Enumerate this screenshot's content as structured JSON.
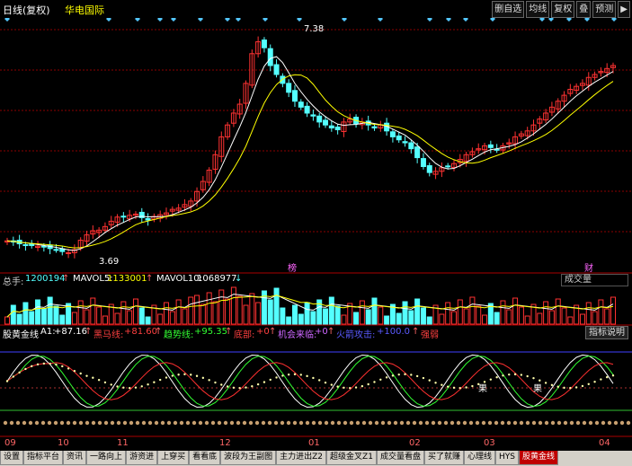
{
  "header": {
    "title": "日线(复权)",
    "stock_name": "华电国际",
    "colors": {
      "title": "#ffffff",
      "name": "#ffff00"
    }
  },
  "toolbar": [
    {
      "label": "删自选",
      "name": "remove-watchlist-button"
    },
    {
      "label": "均线",
      "name": "moving-average-button"
    },
    {
      "label": "复权",
      "name": "adjust-button"
    },
    {
      "label": "叠",
      "name": "overlay-button"
    },
    {
      "label": "预测",
      "name": "forecast-button"
    },
    {
      "label": "▶",
      "name": "expand-icon"
    }
  ],
  "price_chart": {
    "high_label": "7.38",
    "low_label": "3.69",
    "markers": [
      "榜",
      "财"
    ]
  },
  "volume": {
    "total_label": "总手:",
    "total_value": "1200194",
    "mavol5_label": "MAVOL5:",
    "mavol5_value": "1133001",
    "mavol10_label": "MAVOL10:",
    "mavol10_value": "1068977",
    "dropdown_value": "成交量"
  },
  "indicator": {
    "name": "股黄金线",
    "a1_label": "A1:",
    "a1_value": "+87.16",
    "black_horse_label": "黑马线:",
    "black_horse_value": "+81.60",
    "trend_label": "趋势线:",
    "trend_value": "+95.35",
    "bottom_label": "底部:",
    "bottom_value": "+0",
    "chance_label": "机会来临:",
    "chance_value": "+0",
    "attack_label": "火箭攻击:",
    "attack_value": "+100.0",
    "strength_label": "强弱",
    "help_label": "指标说明",
    "guo_label": "果"
  },
  "xaxis": [
    "09",
    "10",
    "11",
    "12",
    "01",
    "02",
    "03",
    "04"
  ],
  "tabs": [
    "设置",
    "指标平台",
    "资讯",
    "一路向上",
    "游资进",
    "上穿买",
    "看看底",
    "波段为王副图",
    "主力进出Z2",
    "超级金叉Z1",
    "成交量看盘",
    "买了就赚",
    "心理线",
    "HYS",
    "股黄金线"
  ],
  "active_tab": "股黄金线",
  "colors": {
    "up": "#ff3232",
    "down": "#54ffff",
    "grid": "#8b0000",
    "ma5": "#ffffff",
    "ma10": "#ffff00"
  },
  "chart_data": {
    "type": "candlestick",
    "closes": [
      3.95,
      3.93,
      3.9,
      3.88,
      3.87,
      3.86,
      3.85,
      3.82,
      3.8,
      3.77,
      3.75,
      3.8,
      3.96,
      4.05,
      4.12,
      4.13,
      4.19,
      4.28,
      4.35,
      4.35,
      4.38,
      4.4,
      4.34,
      4.3,
      4.36,
      4.39,
      4.42,
      4.48,
      4.5,
      4.56,
      4.62,
      4.78,
      4.95,
      5.14,
      5.4,
      5.7,
      5.9,
      6.1,
      6.25,
      6.6,
      7.1,
      7.3,
      7.2,
      6.9,
      6.75,
      6.6,
      6.45,
      6.3,
      6.2,
      6.1,
      6.05,
      5.95,
      5.9,
      5.85,
      5.82,
      5.95,
      6.0,
      5.92,
      5.95,
      5.9,
      5.85,
      5.9,
      5.8,
      5.7,
      5.65,
      5.6,
      5.5,
      5.35,
      5.2,
      5.1,
      5.12,
      5.18,
      5.2,
      5.25,
      5.32,
      5.4,
      5.45,
      5.5,
      5.55,
      5.52,
      5.48,
      5.55,
      5.6,
      5.7,
      5.75,
      5.8,
      5.9,
      6.0,
      6.1,
      6.2,
      6.3,
      6.4,
      6.5,
      6.55,
      6.6,
      6.7,
      6.75,
      6.8,
      6.85,
      6.9
    ]
  }
}
